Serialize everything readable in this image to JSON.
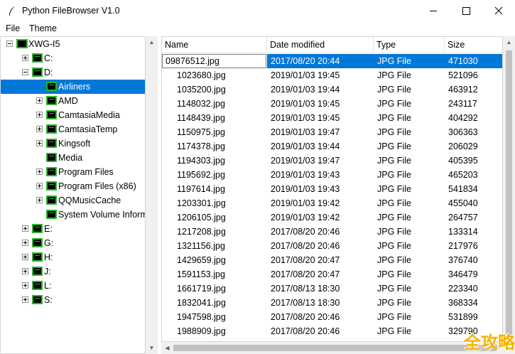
{
  "window": {
    "title": "Python FileBrowser V1.0"
  },
  "menu": [
    "File",
    "Theme"
  ],
  "tree": [
    {
      "label": "XWG-I5",
      "expander": "expanded",
      "level": 0,
      "root": true
    },
    {
      "label": "C:",
      "expander": "collapsed",
      "level": 1
    },
    {
      "label": "D:",
      "expander": "expanded",
      "level": 1
    },
    {
      "label": "Airliners",
      "expander": "none",
      "level": 2,
      "selected": true
    },
    {
      "label": "AMD",
      "expander": "collapsed",
      "level": 2
    },
    {
      "label": "CamtasiaMedia",
      "expander": "collapsed",
      "level": 2
    },
    {
      "label": "CamtasiaTemp",
      "expander": "collapsed",
      "level": 2
    },
    {
      "label": "Kingsoft",
      "expander": "collapsed",
      "level": 2
    },
    {
      "label": "Media",
      "expander": "none",
      "level": 2
    },
    {
      "label": "Program Files",
      "expander": "collapsed",
      "level": 2
    },
    {
      "label": "Program Files (x86)",
      "expander": "collapsed",
      "level": 2
    },
    {
      "label": "QQMusicCache",
      "expander": "collapsed",
      "level": 2
    },
    {
      "label": "System Volume Information",
      "expander": "none",
      "level": 2
    },
    {
      "label": "E:",
      "expander": "collapsed",
      "level": 1
    },
    {
      "label": "G:",
      "expander": "collapsed",
      "level": 1
    },
    {
      "label": "H:",
      "expander": "collapsed",
      "level": 1
    },
    {
      "label": "J:",
      "expander": "collapsed",
      "level": 1
    },
    {
      "label": "L:",
      "expander": "collapsed",
      "level": 1
    },
    {
      "label": "S:",
      "expander": "collapsed",
      "level": 1
    }
  ],
  "list": {
    "columns": [
      "Name",
      "Date modified",
      "Type",
      "Size"
    ],
    "rows": [
      [
        "09876512.jpg",
        "2017/08/20 20:44",
        "JPG File",
        "471030"
      ],
      [
        "1023680.jpg",
        "2019/01/03 19:45",
        "JPG File",
        "521096"
      ],
      [
        "1035200.jpg",
        "2019/01/03 19:44",
        "JPG File",
        "463912"
      ],
      [
        "1148032.jpg",
        "2019/01/03 19:45",
        "JPG File",
        "243117"
      ],
      [
        "1148439.jpg",
        "2019/01/03 19:45",
        "JPG File",
        "404292"
      ],
      [
        "1150975.jpg",
        "2019/01/03 19:47",
        "JPG File",
        "306363"
      ],
      [
        "1174378.jpg",
        "2019/01/03 19:44",
        "JPG File",
        "206029"
      ],
      [
        "1194303.jpg",
        "2019/01/03 19:47",
        "JPG File",
        "405395"
      ],
      [
        "1195692.jpg",
        "2019/01/03 19:43",
        "JPG File",
        "465203"
      ],
      [
        "1197614.jpg",
        "2019/01/03 19:43",
        "JPG File",
        "541834"
      ],
      [
        "1203301.jpg",
        "2019/01/03 19:42",
        "JPG File",
        "455040"
      ],
      [
        "1206105.jpg",
        "2019/01/03 19:42",
        "JPG File",
        "264757"
      ],
      [
        "1217208.jpg",
        "2017/08/20 20:46",
        "JPG File",
        "133314"
      ],
      [
        "1321156.jpg",
        "2017/08/20 20:46",
        "JPG File",
        "217976"
      ],
      [
        "1429659.jpg",
        "2017/08/20 20:47",
        "JPG File",
        "376740"
      ],
      [
        "1591153.jpg",
        "2017/08/20 20:47",
        "JPG File",
        "346479"
      ],
      [
        "1661719.jpg",
        "2017/08/13 18:30",
        "JPG File",
        "223340"
      ],
      [
        "1832041.jpg",
        "2017/08/13 18:30",
        "JPG File",
        "368334"
      ],
      [
        "1947598.jpg",
        "2017/08/20 20:46",
        "JPG File",
        "531899"
      ],
      [
        "1988909.jpg",
        "2017/08/20 20:46",
        "JPG File",
        "329790"
      ]
    ]
  },
  "watermark": "全攻略"
}
